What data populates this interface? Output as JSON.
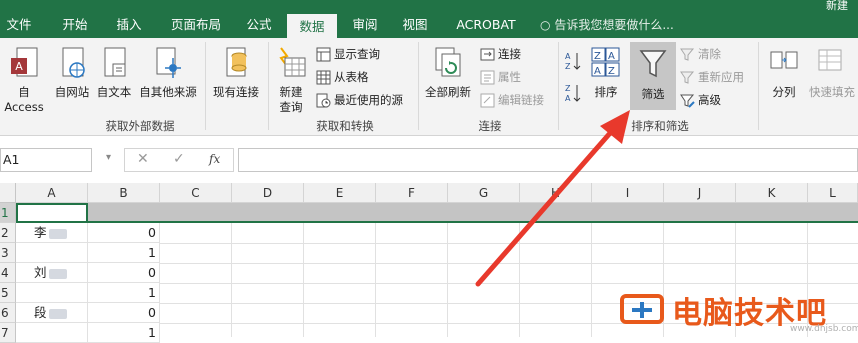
{
  "titlebar": {
    "title": "新建"
  },
  "tabs": [
    {
      "label": "文件"
    },
    {
      "label": "开始"
    },
    {
      "label": "插入"
    },
    {
      "label": "页面布局"
    },
    {
      "label": "公式"
    },
    {
      "label": "数据"
    },
    {
      "label": "审阅"
    },
    {
      "label": "视图"
    },
    {
      "label": "ACROBAT"
    }
  ],
  "tell_me": "告诉我您想要做什么...",
  "ribbon": {
    "external": {
      "access": "自 Access",
      "web": "自网站",
      "text": "自文本",
      "other": "自其他来源",
      "existing": "现有连接",
      "group": "获取外部数据"
    },
    "transform": {
      "new_query": "新建",
      "new_query2": "查询",
      "show_queries": "显示查询",
      "from_table": "从表格",
      "recent_sources": "最近使用的源",
      "group": "获取和转换"
    },
    "connections": {
      "refresh_all": "全部刷新",
      "connections": "连接",
      "properties": "属性",
      "edit_links": "编辑链接",
      "group": "连接"
    },
    "sort_filter": {
      "sort": "排序",
      "filter": "筛选",
      "clear": "清除",
      "reapply": "重新应用",
      "advanced": "高级",
      "group": "排序和筛选"
    },
    "data_tools": {
      "text_to_columns": "分列",
      "flash_fill": "快速填充"
    }
  },
  "formula_bar": {
    "name_box": "A1",
    "fx": "fx",
    "formula": ""
  },
  "columns": [
    "A",
    "B",
    "C",
    "D",
    "E",
    "F",
    "G",
    "H",
    "I",
    "J",
    "K",
    "L"
  ],
  "rows": [
    {
      "num": "1",
      "a": "",
      "b": ""
    },
    {
      "num": "2",
      "a": "李",
      "b": "0"
    },
    {
      "num": "3",
      "a": "",
      "b": "1"
    },
    {
      "num": "4",
      "a": "刘",
      "b": "0"
    },
    {
      "num": "5",
      "a": "",
      "b": "1"
    },
    {
      "num": "6",
      "a": "段",
      "b": "0"
    },
    {
      "num": "7",
      "a": "",
      "b": "1"
    }
  ],
  "watermark": {
    "brand": "电脑技术吧",
    "site": "www.dnjsb.com"
  },
  "colors": {
    "excel_green": "#217346",
    "arrow_red": "#e8392c",
    "brand_orange": "#e8591b"
  }
}
